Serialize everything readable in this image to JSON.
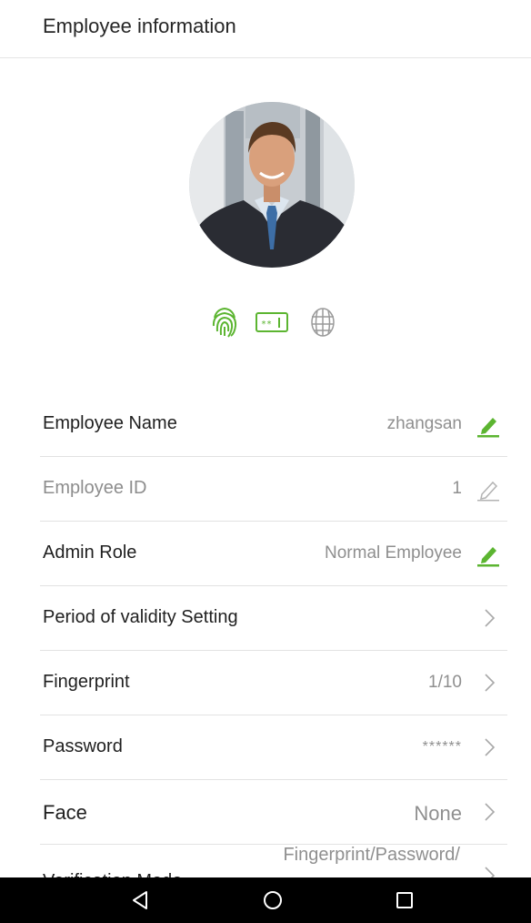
{
  "header": {
    "title": "Employee information"
  },
  "verification_icons": [
    "fingerprint-icon",
    "password-icon",
    "face-icon"
  ],
  "colors": {
    "accent": "#5cb531",
    "muted": "#8f8f8f",
    "divider": "#e2e2e2"
  },
  "fields": [
    {
      "label": "Employee Name",
      "value": "zhangsan",
      "action": "edit"
    },
    {
      "label": "Employee ID",
      "value": "1",
      "action": "edit-disabled"
    },
    {
      "label": "Admin Role",
      "value": "Normal Employee",
      "action": "edit"
    },
    {
      "label": "Period of validity Setting",
      "value": "",
      "action": "chevron"
    },
    {
      "label": "Fingerprint",
      "value": "1/10",
      "action": "chevron"
    },
    {
      "label": "Password",
      "value": "******",
      "action": "chevron"
    },
    {
      "label": "Face",
      "value": "None",
      "action": "chevron"
    },
    {
      "label": "Verification Mode",
      "value": "Fingerprint/Password/",
      "action": "chevron"
    }
  ],
  "navigation": [
    "back-icon",
    "home-icon",
    "recents-icon"
  ]
}
